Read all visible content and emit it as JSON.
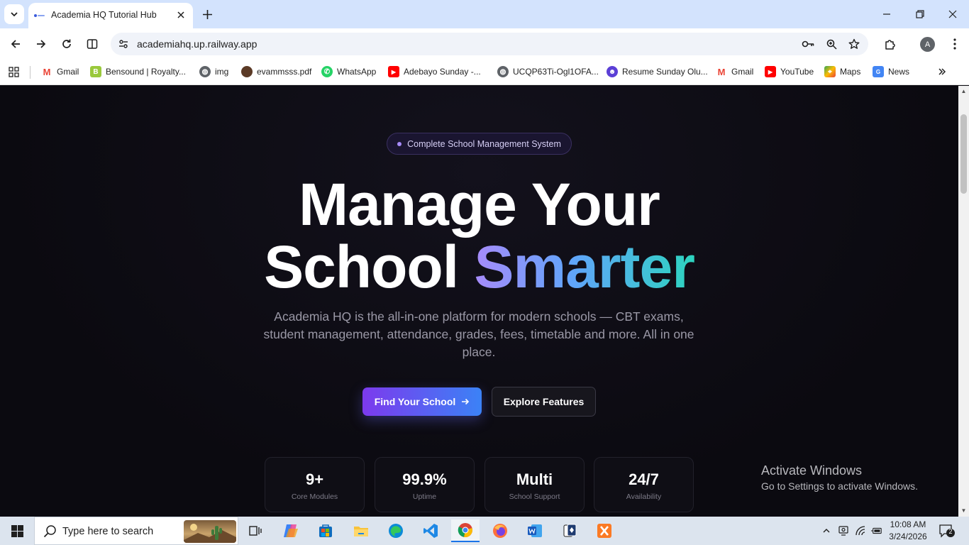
{
  "browser": {
    "tab_title": "Academia HQ Tutorial Hub",
    "url": "academiahq.up.railway.app",
    "profile_initial": "A"
  },
  "bookmarks": [
    {
      "label": "Gmail",
      "icon": "gmail-icon"
    },
    {
      "label": "Bensound | Royalty...",
      "icon": "bensound-icon"
    },
    {
      "label": "img",
      "icon": "globe-icon"
    },
    {
      "label": "evammsss.pdf",
      "icon": "avatar-icon"
    },
    {
      "label": "WhatsApp",
      "icon": "whatsapp-icon"
    },
    {
      "label": "Adebayo Sunday -...",
      "icon": "youtube-icon"
    },
    {
      "label": "UCQP63Ti-Ogl1OFA...",
      "icon": "globe-icon"
    },
    {
      "label": "Resume Sunday Olu...",
      "icon": "resume-icon"
    },
    {
      "label": "Gmail",
      "icon": "gmail-icon"
    },
    {
      "label": "YouTube",
      "icon": "youtube-icon"
    },
    {
      "label": "Maps",
      "icon": "maps-icon"
    },
    {
      "label": "News",
      "icon": "news-icon"
    }
  ],
  "hero": {
    "badge": "Complete School Management System",
    "headline_line1": "Manage Your",
    "headline_line2_plain": "School",
    "headline_line2_gradient": "Smarter",
    "subtitle": "Academia HQ is the all-in-one platform for modern schools — CBT exams, student management, attendance, grades, fees, timetable and more. All in one place.",
    "primary_cta": "Find Your School",
    "secondary_cta": "Explore Features",
    "accent_colors": [
      "#a78bfa",
      "#60a5fa",
      "#2dd4bf"
    ]
  },
  "stats": [
    {
      "value": "9+",
      "label": "Core Modules"
    },
    {
      "value": "99.9%",
      "label": "Uptime"
    },
    {
      "value": "Multi",
      "label": "School Support"
    },
    {
      "value": "24/7",
      "label": "Availability"
    }
  ],
  "watermark": {
    "title": "Activate Windows",
    "subtitle": "Go to Settings to activate Windows."
  },
  "taskbar": {
    "search_placeholder": "Type here to search",
    "time": "10:08 AM",
    "date": "3/24/2026",
    "notification_count": "2"
  }
}
